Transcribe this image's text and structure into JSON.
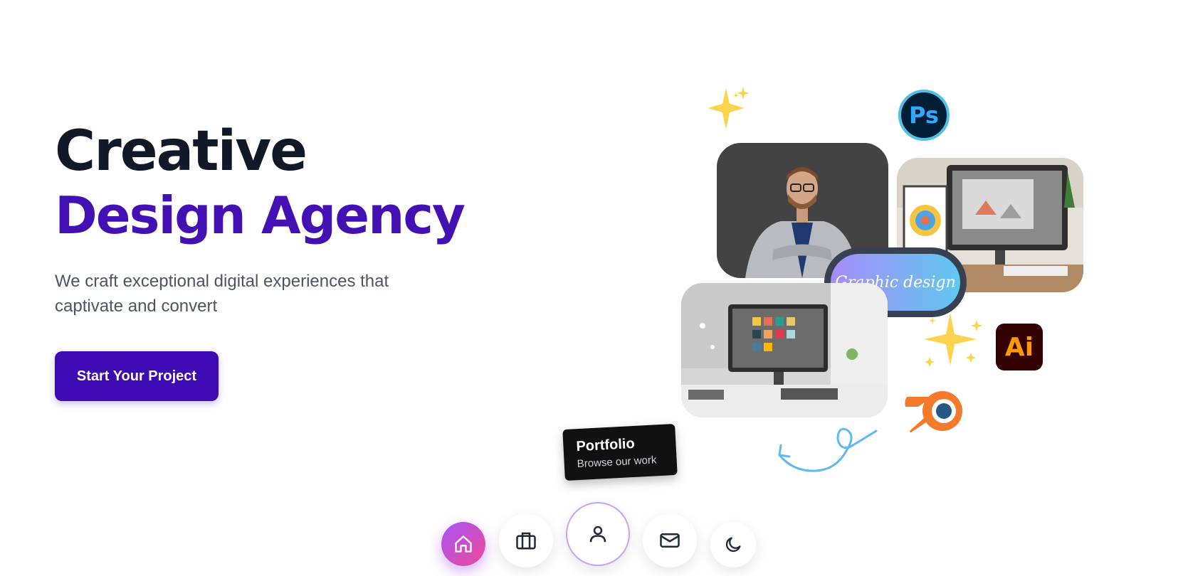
{
  "hero": {
    "title_line1": "Creative",
    "title_line2": "Design Agency",
    "subtitle": "We craft exceptional digital experiences that captivate and convert",
    "cta_label": "Start Your Project"
  },
  "showcase": {
    "pill_label": "Graphic design",
    "ps_badge": "Ps",
    "ai_badge": "Ai",
    "portfolio_title": "Portfolio",
    "portfolio_subtitle": "Browse our work"
  },
  "dock": {
    "items": [
      {
        "icon": "home-icon",
        "active": true
      },
      {
        "icon": "briefcase-icon"
      },
      {
        "icon": "user-icon"
      },
      {
        "icon": "mail-icon"
      },
      {
        "icon": "moon-icon"
      }
    ]
  },
  "colors": {
    "title_dark": "#111827",
    "brand_purple": "#4311b3",
    "cta_bg": "#3d0ab3",
    "ps_blue": "#31a8ff",
    "ai_orange": "#ff9a00",
    "blender_orange": "#f5792a"
  }
}
